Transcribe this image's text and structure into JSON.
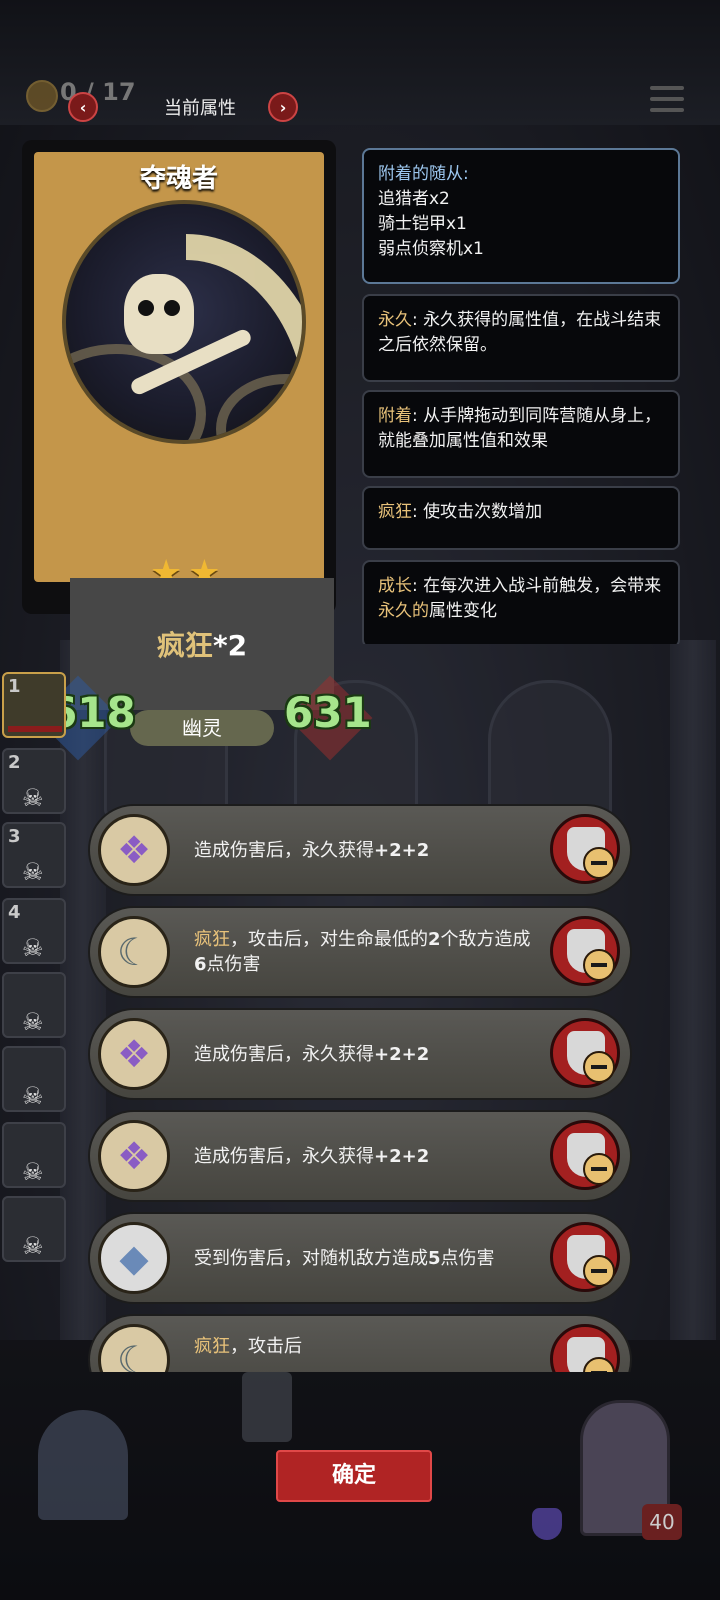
{
  "header": {
    "title": "当前属性",
    "coins": "0 / 17"
  },
  "card": {
    "name": "夺魂者",
    "stars": 2,
    "keyword_label": "疯狂",
    "keyword_value": "*2",
    "attack": "618",
    "health": "631",
    "type": "幽灵"
  },
  "tooltips": {
    "attached": {
      "title": "附着的随从:",
      "lines": [
        "追猎者x2",
        "骑士铠甲x1",
        "弱点侦察机x1"
      ]
    },
    "permanent": {
      "keyword": "永久",
      "text": ": 永久获得的属性值，在战斗结束之后依然保留。"
    },
    "attach": {
      "keyword": "附着",
      "text": ": 从手牌拖动到同阵营随从身上，就能叠加属性值和效果"
    },
    "madness": {
      "keyword": "疯狂",
      "text": ": 使攻击次数增加"
    },
    "growth": {
      "keyword": "成长",
      "text_a": ": 在每次进入战斗前触发，会带来",
      "text_kw": "永久的",
      "text_b": "属性变化"
    }
  },
  "roster": {
    "items": [
      "1",
      "2",
      "3",
      "4",
      "",
      "",
      "",
      ""
    ]
  },
  "effects": [
    {
      "icon": "purple-crystal-icon",
      "prefix": "",
      "text": "造成伤害后，永久获得",
      "num": "+2+2"
    },
    {
      "icon": "scythe-icon",
      "prefix": "疯狂",
      "text": "，攻击后，对生命最低的",
      "num": "2",
      "text2": "个敌方造成",
      "num2": "6",
      "text3": "点伤害"
    },
    {
      "icon": "purple-crystal-icon",
      "prefix": "",
      "text": "造成伤害后，永久获得",
      "num": "+2+2"
    },
    {
      "icon": "purple-crystal-icon",
      "prefix": "",
      "text": "造成伤害后，永久获得",
      "num": "+2+2"
    },
    {
      "icon": "prism-crystal-icon",
      "prefix": "",
      "text": "受到伤害后，对随机敌方造成",
      "num": "5",
      "text2": "点伤害"
    },
    {
      "icon": "scythe-icon",
      "prefix": "疯狂",
      "text": "，攻击后",
      "num": ""
    }
  ],
  "footer": {
    "confirm": "确定",
    "hero_hp": "40"
  },
  "colors": {
    "accent_red": "#b02424",
    "keyword_gold": "#e8c27a",
    "stat_green": "#a6e58c"
  }
}
